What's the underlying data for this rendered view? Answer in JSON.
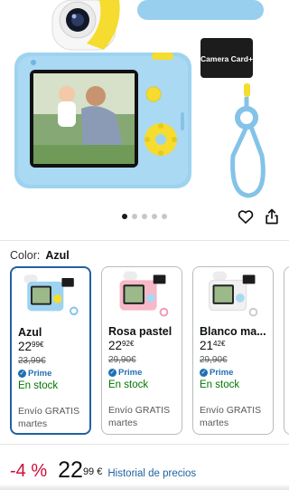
{
  "hero": {
    "memory_card_label": "Camera Card+",
    "image_count": 5,
    "active_image_index": 0
  },
  "actions": {
    "favorite_icon": "heart-outline-icon",
    "share_icon": "share-icon"
  },
  "color_selector": {
    "label": "Color:",
    "selected": "Azul"
  },
  "variants": [
    {
      "name": "Azul",
      "price_whole": "22",
      "price_fraction": "99",
      "currency": "€",
      "list_price": "23,99€",
      "prime": "Prime",
      "stock": "En stock",
      "shipping_line1": "Envío GRATIS",
      "shipping_line2": "martes",
      "selected": true
    },
    {
      "name": "Rosa pastel",
      "price_whole": "22",
      "price_fraction": "92",
      "currency": "€",
      "list_price": "29,90€",
      "prime": "Prime",
      "stock": "En stock",
      "shipping_line1": "Envío GRATIS",
      "shipping_line2": "martes",
      "selected": false
    },
    {
      "name": "Blanco ma...",
      "price_whole": "21",
      "price_fraction": "42",
      "currency": "€",
      "list_price": "29,90€",
      "prime": "Prime",
      "stock": "En stock",
      "shipping_line1": "Envío GRATIS",
      "shipping_line2": "martes",
      "selected": false
    }
  ],
  "price_summary": {
    "discount": "-4 %",
    "price_whole": "22",
    "price_fraction": "99",
    "currency": "€",
    "history_link": "Historial de precios"
  },
  "colors": {
    "accent_blue": "#2162a1",
    "discount_red": "#cc0c39",
    "stock_green": "#007600",
    "prime_blue": "#1f6fb5"
  }
}
